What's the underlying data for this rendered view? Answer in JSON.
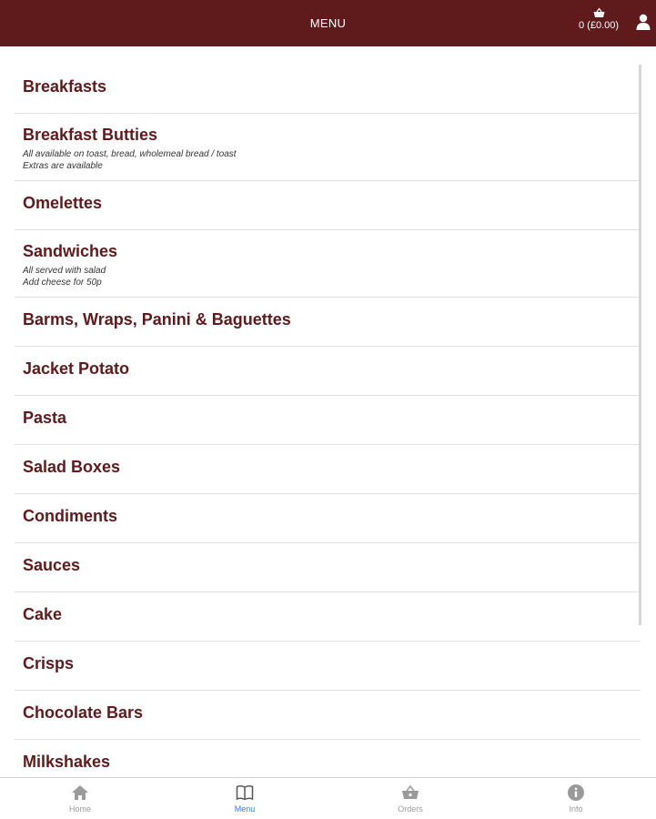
{
  "header": {
    "title": "MENU",
    "basket_label": "0 (£0.00)"
  },
  "menu": {
    "items": [
      {
        "title": "Breakfasts",
        "lines": []
      },
      {
        "title": "Breakfast Butties",
        "lines": [
          "All available on toast, bread, wholemeal bread / toast",
          "Extras are available"
        ]
      },
      {
        "title": "Omelettes",
        "lines": []
      },
      {
        "title": "Sandwiches",
        "lines": [
          "All served with salad",
          "Add cheese for 50p"
        ]
      },
      {
        "title": "Barms, Wraps, Panini & Baguettes",
        "lines": []
      },
      {
        "title": "Jacket Potato",
        "lines": []
      },
      {
        "title": "Pasta",
        "lines": []
      },
      {
        "title": "Salad Boxes",
        "lines": []
      },
      {
        "title": "Condiments",
        "lines": []
      },
      {
        "title": "Sauces",
        "lines": []
      },
      {
        "title": "Cake",
        "lines": []
      },
      {
        "title": "Crisps",
        "lines": []
      },
      {
        "title": "Chocolate Bars",
        "lines": []
      },
      {
        "title": "Milkshakes",
        "lines": []
      }
    ]
  },
  "nav": {
    "home": "Home",
    "menu": "Menu",
    "orders": "Orders",
    "info": "Info",
    "active": "menu"
  },
  "colors": {
    "brand": "#5f1a1c",
    "active": "#3a7bd5",
    "inactive": "#9a9a9a"
  },
  "icons": {
    "basket": "basket-icon",
    "user": "user-icon",
    "home": "home-icon",
    "menu": "book-icon",
    "orders": "basket-icon",
    "info": "info-icon"
  }
}
